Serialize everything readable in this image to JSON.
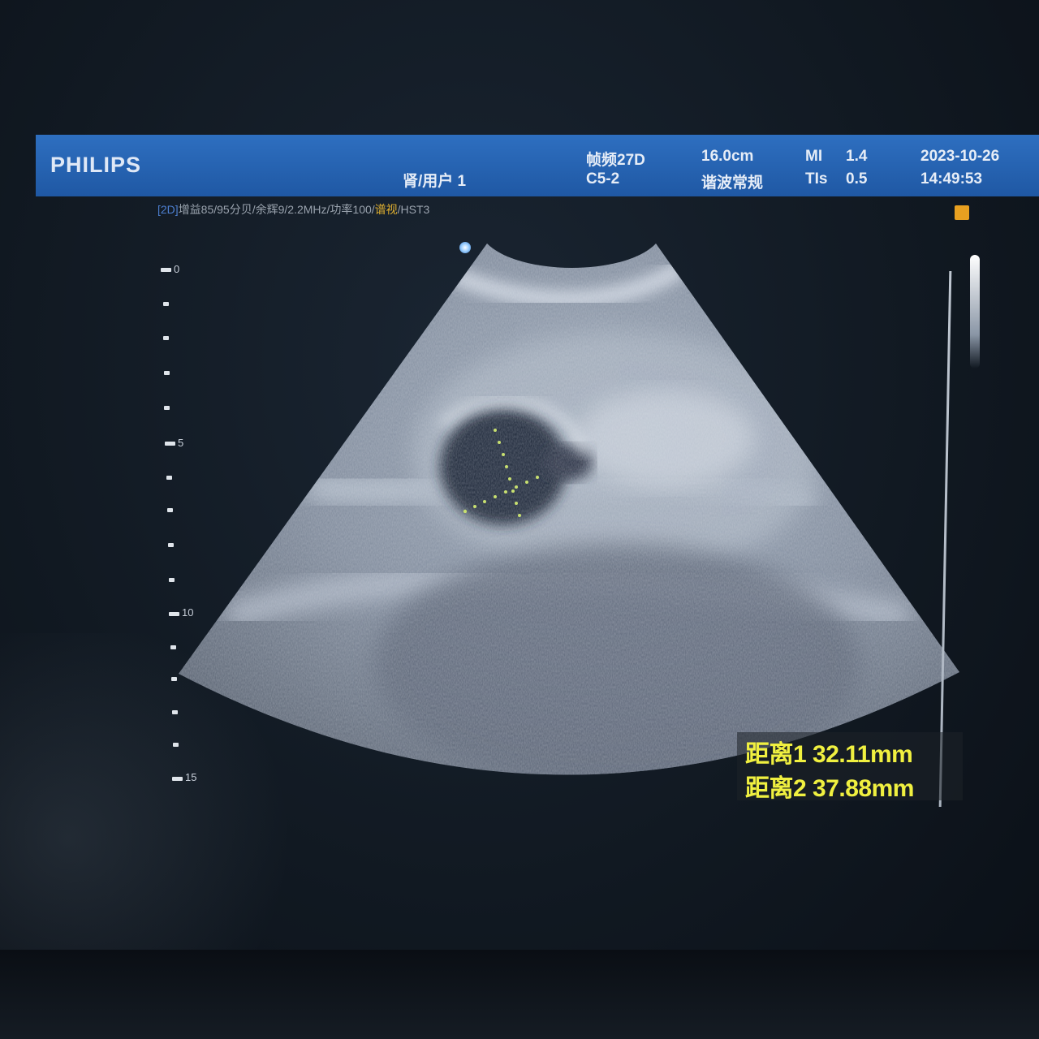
{
  "header": {
    "brand": "PHILIPS",
    "preset": "肾/用户 1",
    "frame_rate_label": "帧频27D",
    "probe": "C5-2",
    "depth": "16.0cm",
    "harmonic_mode": "谐波常规",
    "mi_label": "MI",
    "mi_value": "1.4",
    "tis_label": "TIs",
    "tis_value": "0.5",
    "date": "2023-10-26",
    "time": "14:49:53"
  },
  "params": {
    "mode": "[2D]",
    "settings": "增益85/95分贝/余辉9/2.2MHz/功率100/",
    "chroma": "谱视",
    "suffix": "/HST3"
  },
  "depth_scale": {
    "labels": [
      "0",
      "5",
      "10",
      "15"
    ]
  },
  "measurements": [
    {
      "label": "距离1",
      "value": "32.11mm"
    },
    {
      "label": "距离2",
      "value": "37.88mm"
    }
  ],
  "colors": {
    "header_blue": "#2564b4",
    "measurement_yellow": "#f0f040",
    "caliper_green": "#c8e070",
    "marker_orange": "#e8a020"
  }
}
